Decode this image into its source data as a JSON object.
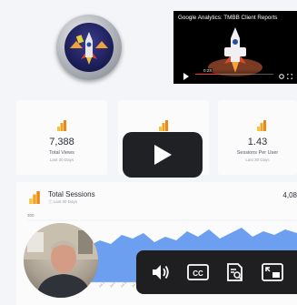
{
  "video": {
    "title": "Google Analytics: TMBB Client Reports",
    "time": "0:23"
  },
  "cards": [
    {
      "value": "7,388",
      "label": "Total Views",
      "sub": "Last 30 Days"
    },
    {
      "value": "",
      "label": "",
      "sub": ""
    },
    {
      "value": "1.43",
      "label": "Sessions Per User",
      "sub": "Last 30 Days"
    }
  ],
  "sessions": {
    "title": "Total Sessions",
    "subtitle": "ⓘ Last 30 Days",
    "value": "4,08",
    "axis_label": "300"
  },
  "colors": {
    "accent": "#f5a31b",
    "chart_fill": "#6c9ff0",
    "bar_dark": "#1f1f21"
  },
  "icons": {
    "play": "play-icon",
    "volume": "volume-icon",
    "captions": "captions-icon",
    "transcript": "transcript-icon",
    "pip": "picture-in-picture-icon"
  }
}
